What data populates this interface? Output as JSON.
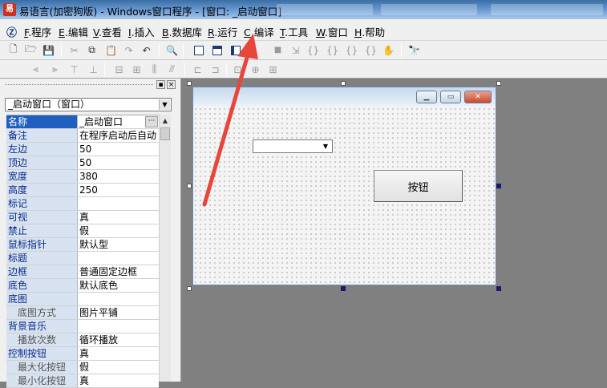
{
  "window": {
    "title": "易语言(加密狗版) - Windows窗口程序 - [窗口: _启动窗口]"
  },
  "menu": [
    {
      "key": "F",
      "label": ".程序"
    },
    {
      "key": "E",
      "label": ".编辑"
    },
    {
      "key": "V",
      "label": ".查看"
    },
    {
      "key": "I",
      "label": ".插入"
    },
    {
      "key": "B",
      "label": ".数据库"
    },
    {
      "key": "R",
      "label": ".运行"
    },
    {
      "key": "C",
      "label": ".编译"
    },
    {
      "key": "T",
      "label": ".工具"
    },
    {
      "key": "W",
      "label": ".窗口"
    },
    {
      "key": "H",
      "label": ".帮助"
    }
  ],
  "properties": {
    "object_selector": "_启动窗口（窗口）",
    "rows": [
      {
        "name": "名称",
        "value": "_启动窗口",
        "selected": true,
        "has_button": true
      },
      {
        "name": "备注",
        "value": "在程序启动后自动"
      },
      {
        "name": "左边",
        "value": "50"
      },
      {
        "name": "顶边",
        "value": "50"
      },
      {
        "name": "宽度",
        "value": "380"
      },
      {
        "name": "高度",
        "value": "250"
      },
      {
        "name": "标记",
        "value": ""
      },
      {
        "name": "可视",
        "value": "真"
      },
      {
        "name": "禁止",
        "value": "假"
      },
      {
        "name": "鼠标指针",
        "value": "默认型"
      },
      {
        "name": "标题",
        "value": ""
      },
      {
        "name": "边框",
        "value": "普通固定边框"
      },
      {
        "name": "底色",
        "value": "默认底色"
      },
      {
        "name": "底图",
        "value": ""
      },
      {
        "name": "底图方式",
        "value": "图片平铺",
        "sub": true
      },
      {
        "name": "背景音乐",
        "value": ""
      },
      {
        "name": "播放次数",
        "value": "循环播放",
        "sub": true
      },
      {
        "name": "控制按钮",
        "value": "真"
      },
      {
        "name": "最大化按钮",
        "value": "假",
        "sub": true
      },
      {
        "name": "最小化按钮",
        "value": "真",
        "sub": true
      }
    ]
  },
  "form": {
    "button_label": "按钮"
  },
  "colors": {
    "annotation_arrow": "#e8463a",
    "selected_row": "#1f5fbf"
  }
}
